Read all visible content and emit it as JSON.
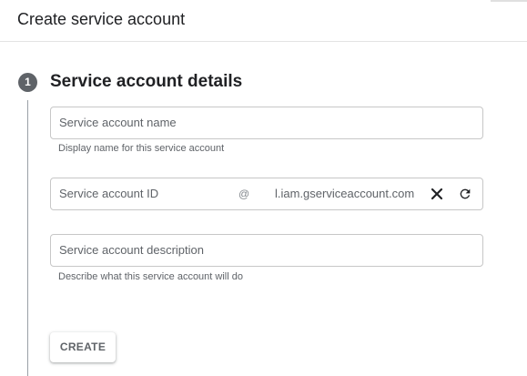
{
  "header": {
    "title": "Create service account"
  },
  "step": {
    "number": "1",
    "title": "Service account details"
  },
  "fields": {
    "name": {
      "label": "Service account name",
      "hint": "Display name for this service account"
    },
    "id": {
      "label": "Service account ID",
      "at": "@",
      "domain": "l.iam.gserviceaccount.com",
      "clear_icon": "close-icon",
      "refresh_icon": "refresh-icon"
    },
    "description": {
      "label": "Service account description",
      "hint": "Describe what this service account will do"
    }
  },
  "actions": {
    "create_label": "CREATE"
  },
  "colors": {
    "step_badge": "#5f6368",
    "border": "#c7c7c7",
    "muted_text": "#5f6368"
  }
}
